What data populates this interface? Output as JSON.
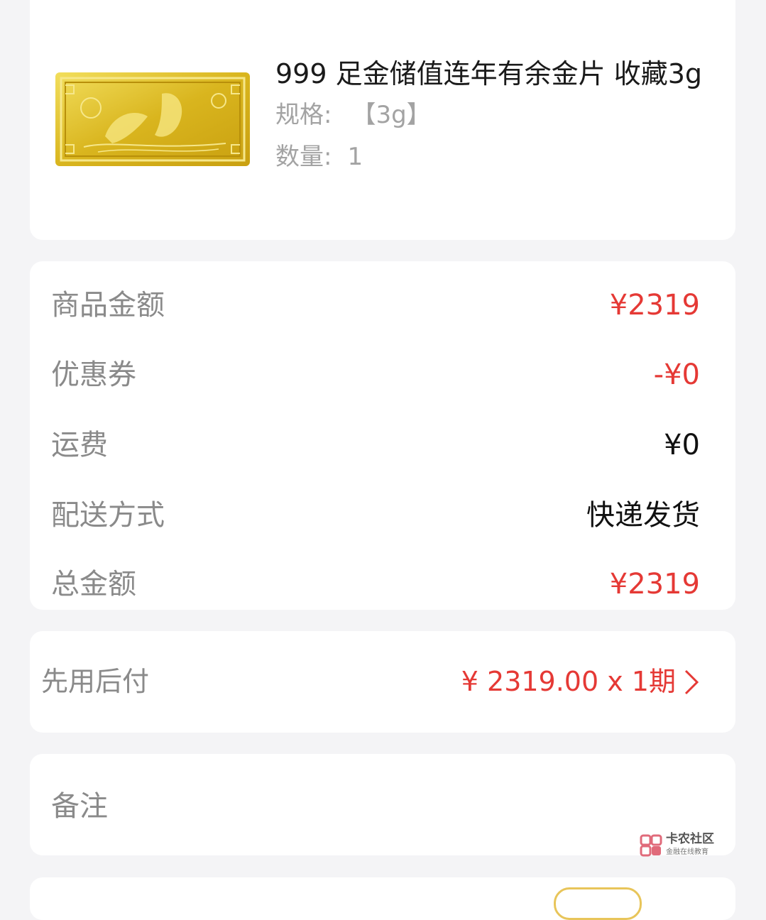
{
  "product": {
    "title": "999 足金储值连年有余金片 收藏3g",
    "spec_label": "规格:",
    "spec_value": "【3g】",
    "qty_label": "数量:",
    "qty_value": "1",
    "image_icon": "gold-bar-image"
  },
  "summary": {
    "rows": [
      {
        "label": "商品金额",
        "value": "¥2319",
        "color": "#e53935"
      },
      {
        "label": "优惠券",
        "value": "-¥0",
        "color": "#e53935"
      },
      {
        "label": "运费",
        "value": "¥0",
        "color": "#111111"
      },
      {
        "label": "配送方式",
        "value": "快递发货",
        "color": "#111111"
      },
      {
        "label": "总金额",
        "value": "¥2319",
        "color": "#e53935"
      }
    ]
  },
  "payment": {
    "label": "先用后付",
    "value": "¥ 2319.00 x 1期",
    "icon": "chevron-right-icon"
  },
  "remark": {
    "label": "备注"
  },
  "watermark": {
    "title": "卡农社区",
    "subtitle": "金融在线教育"
  },
  "colors": {
    "accent_red": "#e53935",
    "background": "#f4f4f6",
    "gold": "#d4b020"
  }
}
